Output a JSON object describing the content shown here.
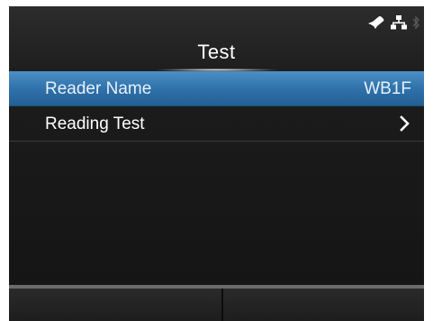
{
  "header": {
    "title": "Test",
    "status_icons": [
      "rfid-pen-icon",
      "network-icon",
      "bluetooth-icon"
    ]
  },
  "menu": {
    "items": [
      {
        "label": "Reader Name",
        "value": "WB1F",
        "selected": true
      },
      {
        "label": "Reading Test",
        "icon": "chevron-right-icon",
        "selected": false
      }
    ]
  },
  "footer": {
    "buttons": [
      {
        "label": ""
      },
      {
        "label": ""
      }
    ]
  },
  "colors": {
    "selected_row": "#2f72ab",
    "background": "#1a1a1a",
    "text": "#ffffff"
  }
}
